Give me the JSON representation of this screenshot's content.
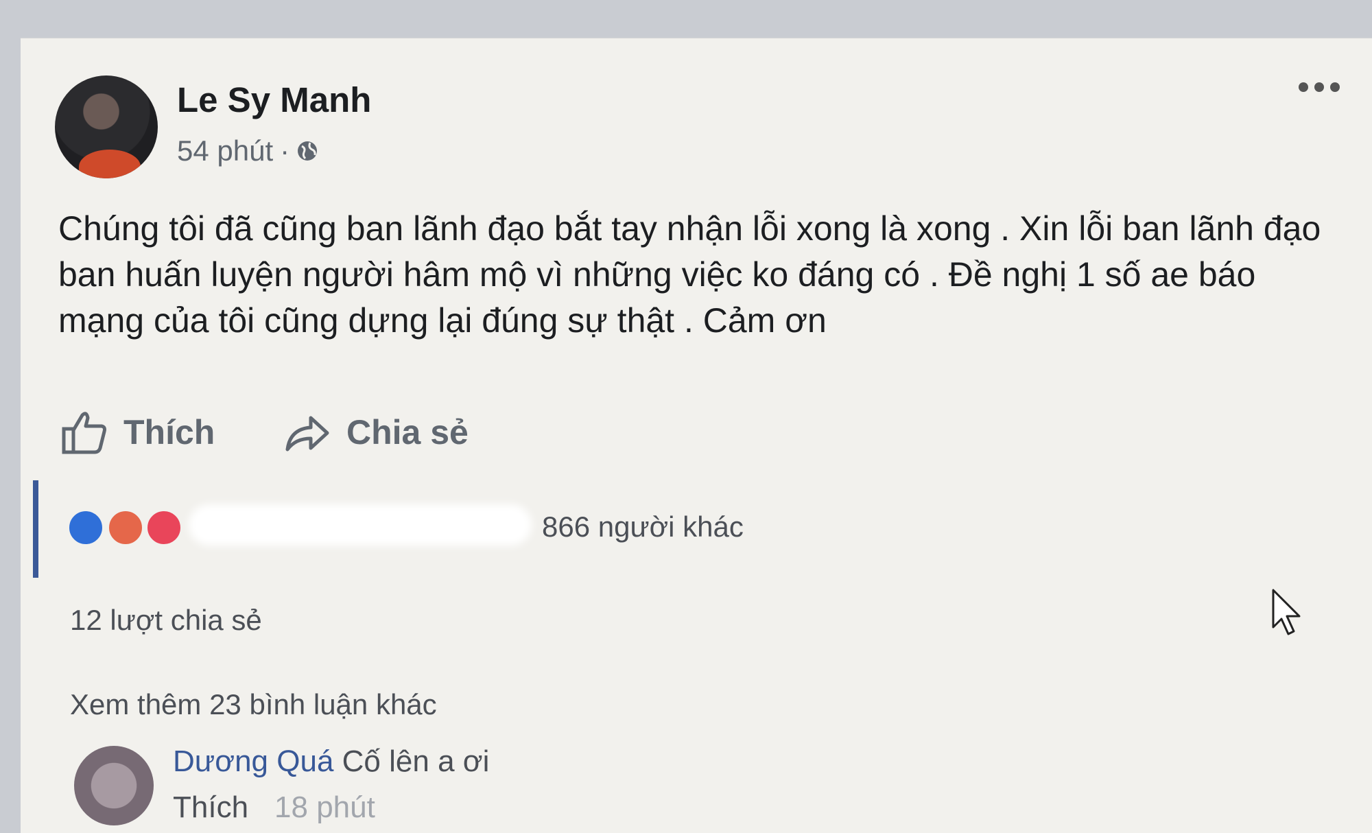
{
  "post": {
    "author": "Le Sy Manh",
    "time": "54 phút",
    "separator": "·",
    "privacy_icon": "globe-icon",
    "menu_icon": "more-options-icon",
    "text": "Chúng tôi đã cũng ban lãnh đạo bắt tay nhận lỗi xong là xong . Xin lỗi ban lãnh đạo ban huấn luyện người hâm mộ vì những việc ko đáng có . Đề nghị 1 số ae báo mạng của tôi cũng dựng lại đúng sự thật . Cảm ơn"
  },
  "actions": {
    "like_label": "Thích",
    "share_label": "Chia sẻ"
  },
  "stats": {
    "reaction_icons": [
      "like-reaction-icon",
      "angry-reaction-icon",
      "love-reaction-icon"
    ],
    "reactions_text": "866 người khác",
    "shares_text": "12 lượt chia sẻ"
  },
  "comments": {
    "view_more": "Xem thêm 23 bình luận khác",
    "items": [
      {
        "name": "Dương Quá",
        "text": "Cố lên a ơi",
        "like_label": "Thích",
        "time": "18 phút"
      }
    ]
  },
  "colors": {
    "link": "#385898",
    "like_reaction": "#2f6fd8",
    "angry_reaction": "#e5674a",
    "love_reaction": "#e9455a"
  }
}
